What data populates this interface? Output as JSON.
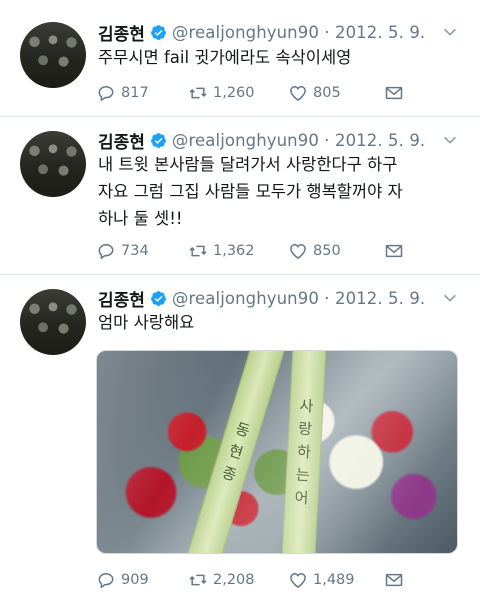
{
  "tweets": [
    {
      "name": "김종현",
      "handle": "@realjonghyun90 · 2012. 5. 9.",
      "text_lines": [
        "주무시면 fail 귓가에라도 속삭이세영"
      ],
      "replies": "817",
      "retweets": "1,260",
      "likes": "805"
    },
    {
      "name": "김종현",
      "handle": "@realjonghyun90 · 2012. 5. 9.",
      "text_lines": [
        "내 트윗 본사람들 달려가서 사랑한다구 하구",
        "자요 그럼 그집 사람들 모두가 행복할꺼야 자",
        "하나 둘 셋!!"
      ],
      "replies": "734",
      "retweets": "1,362",
      "likes": "850"
    },
    {
      "name": "김종현",
      "handle": "@realjonghyun90 · 2012. 5. 9.",
      "text_lines": [
        "엄마 사랑해요"
      ],
      "replies": "909",
      "retweets": "2,208",
      "likes": "1,489",
      "media": {
        "ribbon_left": [
          "동",
          "현",
          "종"
        ],
        "ribbon_right": [
          "사",
          "랑",
          "하",
          "는",
          "어"
        ]
      }
    }
  ],
  "colors": {
    "verified": "#1da1f2",
    "secondary_text": "#657786",
    "divider": "#e1e8ed"
  },
  "icons": {
    "reply": "reply-icon",
    "retweet": "retweet-icon",
    "like": "heart-icon",
    "dm": "envelope-icon",
    "verified": "verified-badge-icon",
    "menu": "chevron-down-icon"
  }
}
